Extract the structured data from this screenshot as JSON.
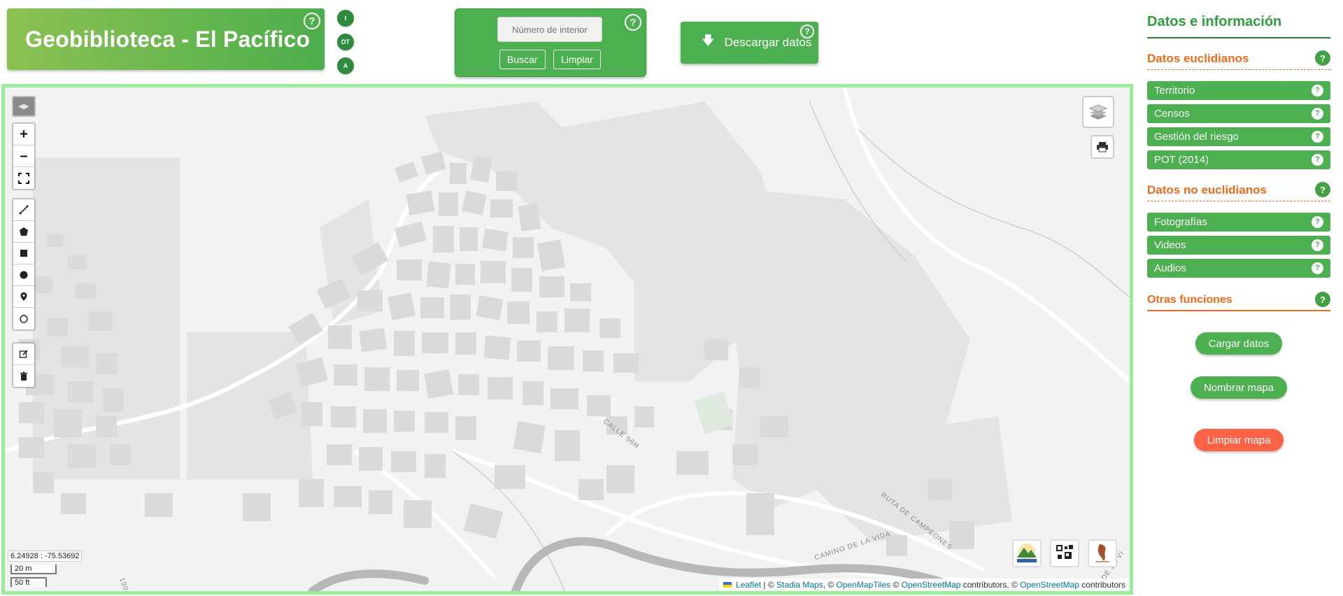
{
  "header": {
    "title": "Geobiblioteca - El Pacífico",
    "help": "?",
    "mini_buttons": [
      "I",
      "DT",
      "A"
    ]
  },
  "search": {
    "placeholder": "Número de interior",
    "help": "?",
    "search_label": "Buscar",
    "clear_label": "Limpiar"
  },
  "download": {
    "label": "Descargar datos",
    "help": "?"
  },
  "map": {
    "coords": "6.24928 : -75.53692",
    "scale_metric": "20 m",
    "scale_imperial": "50 ft",
    "street_labels": [
      "CALLE 56H",
      "RUTA DE CAMPEONES",
      "CAMINO DE LA VIDA",
      "190",
      "DE LA VI"
    ],
    "attribution": {
      "leaflet": "Leaflet",
      "sep1": " | © ",
      "stadia": "Stadia Maps",
      "sep2": ", © ",
      "omt": "OpenMapTiles",
      "sep3": " © ",
      "osm1": "OpenStreetMap",
      "sep4": " contributors, © ",
      "osm2": "OpenStreetMap",
      "sep5": " contributors"
    },
    "logos": [
      "el-pacifico-logo",
      "qr-logo",
      "cartoslab-logo"
    ]
  },
  "panel": {
    "title": "Datos e información",
    "sections": {
      "euclidean": {
        "label": "Datos euclidianos",
        "items": [
          "Territorio",
          "Censos",
          "Gestión del riesgo",
          "POT (2014)"
        ]
      },
      "non_euclidean": {
        "label": "Datos no euclidianos",
        "items": [
          "Fotografías",
          "Videos",
          "Audios"
        ]
      },
      "other": {
        "label": "Otras funciones"
      }
    },
    "actions": {
      "load": "Cargar datos",
      "name": "Nombrar mapa",
      "clear": "Limpiar mapa"
    },
    "help": "?"
  },
  "colors": {
    "primary_green": "#4caf50",
    "accent_orange": "#f06a1c",
    "danger_red": "#ff6347",
    "map_border": "#98ee98"
  }
}
